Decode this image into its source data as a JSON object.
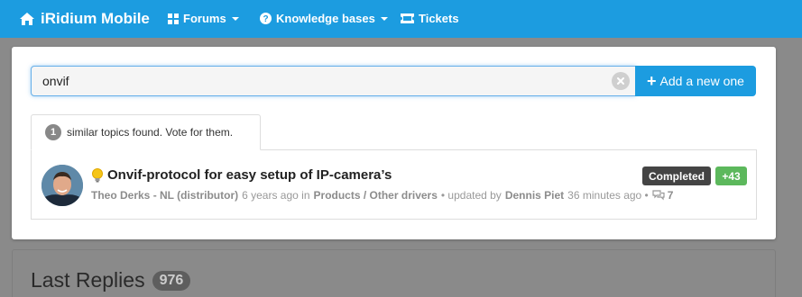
{
  "navbar": {
    "brand": "iRidium Mobile",
    "items": [
      {
        "label": "Forums",
        "icon": "th-large-icon",
        "dropdown": true
      },
      {
        "label": "Knowledge bases",
        "icon": "question-circle-icon",
        "dropdown": true
      },
      {
        "label": "Tickets",
        "icon": "ticket-icon",
        "dropdown": false
      }
    ]
  },
  "search": {
    "value": "onvif",
    "add_button_label": "Add a new one"
  },
  "similar": {
    "count": "1",
    "tab_text": "similar topics found. Vote for them."
  },
  "topic": {
    "title": "Onvif-protocol for easy setup of IP-camera’s",
    "author": "Theo Derks - NL (distributor)",
    "age": "6 years ago in",
    "category": "Products / Other drivers",
    "updated_text": "• updated by",
    "updated_by": "Dennis Piet",
    "updated_age": "36 minutes ago •",
    "comments": "7",
    "status": "Completed",
    "votes": "+43"
  },
  "last_replies": {
    "title": "Last Replies",
    "count": "976"
  },
  "colors": {
    "navbar": "#1c9ce0",
    "completed_badge": "#444444",
    "votes_badge": "#5cb85c"
  }
}
